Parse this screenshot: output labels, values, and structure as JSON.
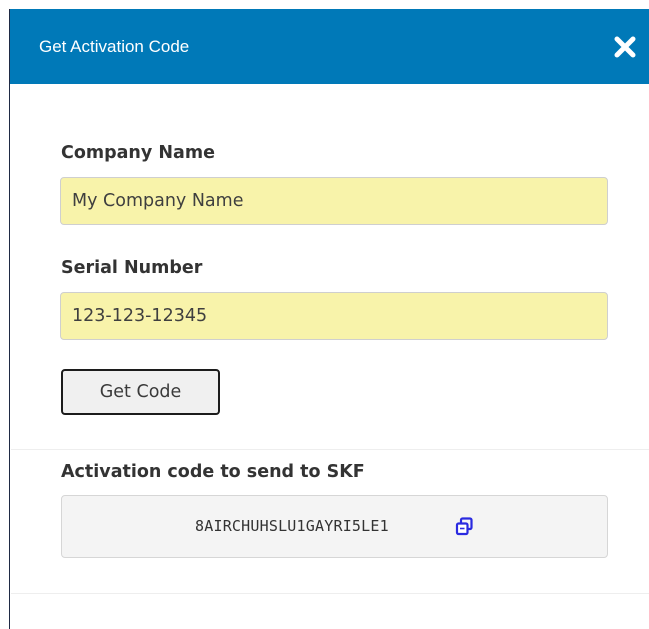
{
  "dialog": {
    "title": "Get Activation Code",
    "close_icon": "close-icon"
  },
  "form": {
    "company_label": "Company Name",
    "company_value": "My Company Name",
    "serial_label": "Serial Number",
    "serial_value": "123-123-12345",
    "get_code_label": "Get Code"
  },
  "result": {
    "label": "Activation code to send to SKF",
    "code": "8AIRCHUHSLU1GAYRI5LE1",
    "copy_icon": "copy-icon"
  },
  "colors": {
    "header_bg": "#0079b8",
    "input_bg": "#f8f3aa",
    "copy_icon": "#2a2ae0"
  }
}
